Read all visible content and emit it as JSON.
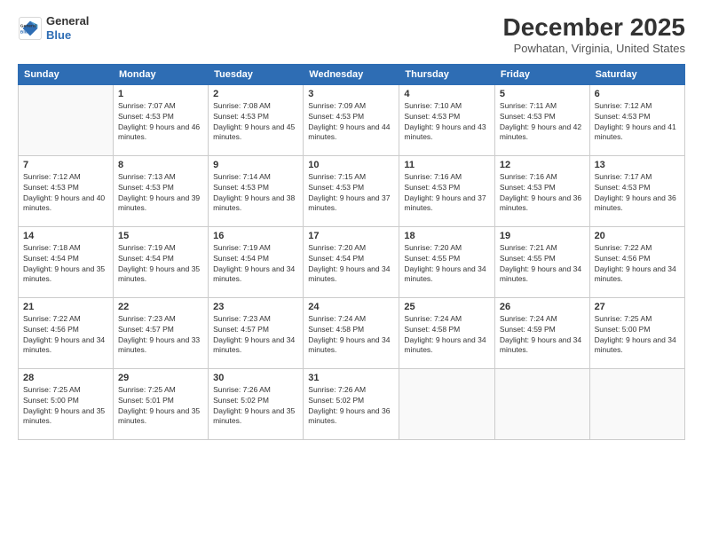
{
  "logo": {
    "line1": "General",
    "line2": "Blue"
  },
  "title": "December 2025",
  "location": "Powhatan, Virginia, United States",
  "weekdays": [
    "Sunday",
    "Monday",
    "Tuesday",
    "Wednesday",
    "Thursday",
    "Friday",
    "Saturday"
  ],
  "weeks": [
    [
      {
        "day": "",
        "sunrise": "",
        "sunset": "",
        "daylight": ""
      },
      {
        "day": "1",
        "sunrise": "Sunrise: 7:07 AM",
        "sunset": "Sunset: 4:53 PM",
        "daylight": "Daylight: 9 hours and 46 minutes."
      },
      {
        "day": "2",
        "sunrise": "Sunrise: 7:08 AM",
        "sunset": "Sunset: 4:53 PM",
        "daylight": "Daylight: 9 hours and 45 minutes."
      },
      {
        "day": "3",
        "sunrise": "Sunrise: 7:09 AM",
        "sunset": "Sunset: 4:53 PM",
        "daylight": "Daylight: 9 hours and 44 minutes."
      },
      {
        "day": "4",
        "sunrise": "Sunrise: 7:10 AM",
        "sunset": "Sunset: 4:53 PM",
        "daylight": "Daylight: 9 hours and 43 minutes."
      },
      {
        "day": "5",
        "sunrise": "Sunrise: 7:11 AM",
        "sunset": "Sunset: 4:53 PM",
        "daylight": "Daylight: 9 hours and 42 minutes."
      },
      {
        "day": "6",
        "sunrise": "Sunrise: 7:12 AM",
        "sunset": "Sunset: 4:53 PM",
        "daylight": "Daylight: 9 hours and 41 minutes."
      }
    ],
    [
      {
        "day": "7",
        "sunrise": "Sunrise: 7:12 AM",
        "sunset": "Sunset: 4:53 PM",
        "daylight": "Daylight: 9 hours and 40 minutes."
      },
      {
        "day": "8",
        "sunrise": "Sunrise: 7:13 AM",
        "sunset": "Sunset: 4:53 PM",
        "daylight": "Daylight: 9 hours and 39 minutes."
      },
      {
        "day": "9",
        "sunrise": "Sunrise: 7:14 AM",
        "sunset": "Sunset: 4:53 PM",
        "daylight": "Daylight: 9 hours and 38 minutes."
      },
      {
        "day": "10",
        "sunrise": "Sunrise: 7:15 AM",
        "sunset": "Sunset: 4:53 PM",
        "daylight": "Daylight: 9 hours and 37 minutes."
      },
      {
        "day": "11",
        "sunrise": "Sunrise: 7:16 AM",
        "sunset": "Sunset: 4:53 PM",
        "daylight": "Daylight: 9 hours and 37 minutes."
      },
      {
        "day": "12",
        "sunrise": "Sunrise: 7:16 AM",
        "sunset": "Sunset: 4:53 PM",
        "daylight": "Daylight: 9 hours and 36 minutes."
      },
      {
        "day": "13",
        "sunrise": "Sunrise: 7:17 AM",
        "sunset": "Sunset: 4:53 PM",
        "daylight": "Daylight: 9 hours and 36 minutes."
      }
    ],
    [
      {
        "day": "14",
        "sunrise": "Sunrise: 7:18 AM",
        "sunset": "Sunset: 4:54 PM",
        "daylight": "Daylight: 9 hours and 35 minutes."
      },
      {
        "day": "15",
        "sunrise": "Sunrise: 7:19 AM",
        "sunset": "Sunset: 4:54 PM",
        "daylight": "Daylight: 9 hours and 35 minutes."
      },
      {
        "day": "16",
        "sunrise": "Sunrise: 7:19 AM",
        "sunset": "Sunset: 4:54 PM",
        "daylight": "Daylight: 9 hours and 34 minutes."
      },
      {
        "day": "17",
        "sunrise": "Sunrise: 7:20 AM",
        "sunset": "Sunset: 4:54 PM",
        "daylight": "Daylight: 9 hours and 34 minutes."
      },
      {
        "day": "18",
        "sunrise": "Sunrise: 7:20 AM",
        "sunset": "Sunset: 4:55 PM",
        "daylight": "Daylight: 9 hours and 34 minutes."
      },
      {
        "day": "19",
        "sunrise": "Sunrise: 7:21 AM",
        "sunset": "Sunset: 4:55 PM",
        "daylight": "Daylight: 9 hours and 34 minutes."
      },
      {
        "day": "20",
        "sunrise": "Sunrise: 7:22 AM",
        "sunset": "Sunset: 4:56 PM",
        "daylight": "Daylight: 9 hours and 34 minutes."
      }
    ],
    [
      {
        "day": "21",
        "sunrise": "Sunrise: 7:22 AM",
        "sunset": "Sunset: 4:56 PM",
        "daylight": "Daylight: 9 hours and 34 minutes."
      },
      {
        "day": "22",
        "sunrise": "Sunrise: 7:23 AM",
        "sunset": "Sunset: 4:57 PM",
        "daylight": "Daylight: 9 hours and 33 minutes."
      },
      {
        "day": "23",
        "sunrise": "Sunrise: 7:23 AM",
        "sunset": "Sunset: 4:57 PM",
        "daylight": "Daylight: 9 hours and 34 minutes."
      },
      {
        "day": "24",
        "sunrise": "Sunrise: 7:24 AM",
        "sunset": "Sunset: 4:58 PM",
        "daylight": "Daylight: 9 hours and 34 minutes."
      },
      {
        "day": "25",
        "sunrise": "Sunrise: 7:24 AM",
        "sunset": "Sunset: 4:58 PM",
        "daylight": "Daylight: 9 hours and 34 minutes."
      },
      {
        "day": "26",
        "sunrise": "Sunrise: 7:24 AM",
        "sunset": "Sunset: 4:59 PM",
        "daylight": "Daylight: 9 hours and 34 minutes."
      },
      {
        "day": "27",
        "sunrise": "Sunrise: 7:25 AM",
        "sunset": "Sunset: 5:00 PM",
        "daylight": "Daylight: 9 hours and 34 minutes."
      }
    ],
    [
      {
        "day": "28",
        "sunrise": "Sunrise: 7:25 AM",
        "sunset": "Sunset: 5:00 PM",
        "daylight": "Daylight: 9 hours and 35 minutes."
      },
      {
        "day": "29",
        "sunrise": "Sunrise: 7:25 AM",
        "sunset": "Sunset: 5:01 PM",
        "daylight": "Daylight: 9 hours and 35 minutes."
      },
      {
        "day": "30",
        "sunrise": "Sunrise: 7:26 AM",
        "sunset": "Sunset: 5:02 PM",
        "daylight": "Daylight: 9 hours and 35 minutes."
      },
      {
        "day": "31",
        "sunrise": "Sunrise: 7:26 AM",
        "sunset": "Sunset: 5:02 PM",
        "daylight": "Daylight: 9 hours and 36 minutes."
      },
      {
        "day": "",
        "sunrise": "",
        "sunset": "",
        "daylight": ""
      },
      {
        "day": "",
        "sunrise": "",
        "sunset": "",
        "daylight": ""
      },
      {
        "day": "",
        "sunrise": "",
        "sunset": "",
        "daylight": ""
      }
    ]
  ]
}
